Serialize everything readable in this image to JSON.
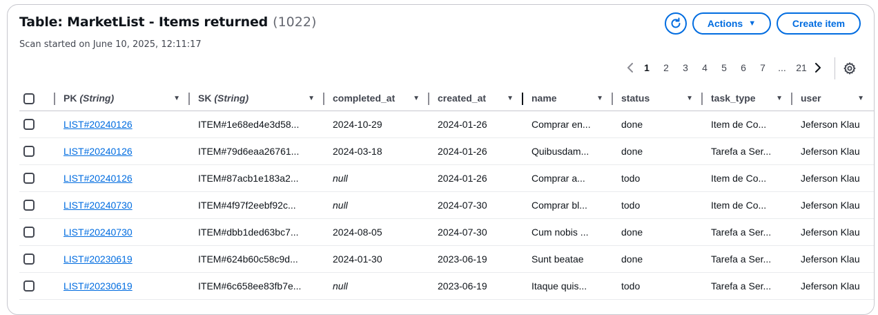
{
  "header": {
    "title": "Table: MarketList - Items returned",
    "count": "(1022)",
    "subtitle": "Scan started on June 10, 2025, 12:11:17",
    "actions_label": "Actions",
    "create_label": "Create item"
  },
  "pagination": {
    "pages": [
      "1",
      "2",
      "3",
      "4",
      "5",
      "6",
      "7"
    ],
    "current": "1",
    "ellipsis": "...",
    "last": "21"
  },
  "columns": [
    {
      "label": "PK",
      "type": "(String)"
    },
    {
      "label": "SK",
      "type": "(String)"
    },
    {
      "label": "completed_at",
      "type": ""
    },
    {
      "label": "created_at",
      "type": ""
    },
    {
      "label": "name",
      "type": ""
    },
    {
      "label": "status",
      "type": ""
    },
    {
      "label": "task_type",
      "type": ""
    },
    {
      "label": "user",
      "type": ""
    }
  ],
  "rows": [
    {
      "pk": "LIST#20240126",
      "sk": "ITEM#1e68ed4e3d58...",
      "completed_at": "2024-10-29",
      "created_at": "2024-01-26",
      "name": "Comprar en...",
      "status": "done",
      "task_type": "Item de Co...",
      "user": "Jeferson Klau"
    },
    {
      "pk": "LIST#20240126",
      "sk": "ITEM#79d6eaa26761...",
      "completed_at": "2024-03-18",
      "created_at": "2024-01-26",
      "name": "Quibusdam...",
      "status": "done",
      "task_type": "Tarefa a Ser...",
      "user": "Jeferson Klau"
    },
    {
      "pk": "LIST#20240126",
      "sk": "ITEM#87acb1e183a2...",
      "completed_at": "null",
      "created_at": "2024-01-26",
      "name": "Comprar a...",
      "status": "todo",
      "task_type": "Item de Co...",
      "user": "Jeferson Klau"
    },
    {
      "pk": "LIST#20240730",
      "sk": "ITEM#4f97f2eebf92c...",
      "completed_at": "null",
      "created_at": "2024-07-30",
      "name": "Comprar bl...",
      "status": "todo",
      "task_type": "Item de Co...",
      "user": "Jeferson Klau"
    },
    {
      "pk": "LIST#20240730",
      "sk": "ITEM#dbb1ded63bc7...",
      "completed_at": "2024-08-05",
      "created_at": "2024-07-30",
      "name": "Cum nobis ...",
      "status": "done",
      "task_type": "Tarefa a Ser...",
      "user": "Jeferson Klau"
    },
    {
      "pk": "LIST#20230619",
      "sk": "ITEM#624b60c58c9d...",
      "completed_at": "2024-01-30",
      "created_at": "2023-06-19",
      "name": "Sunt beatae",
      "status": "done",
      "task_type": "Tarefa a Ser...",
      "user": "Jeferson Klau"
    },
    {
      "pk": "LIST#20230619",
      "sk": "ITEM#6c658ee83fb7e...",
      "completed_at": "null",
      "created_at": "2023-06-19",
      "name": "Itaque quis...",
      "status": "todo",
      "task_type": "Tarefa a Ser...",
      "user": "Jeferson Klau"
    }
  ],
  "icons": {
    "refresh": "refresh-icon",
    "settings": "gear-icon",
    "caret": "caret-down-icon",
    "prev": "chevron-left-icon",
    "next": "chevron-right-icon"
  },
  "colors": {
    "accent": "#006ce0",
    "text": "#0f141a",
    "muted": "#424650",
    "border": "#c6c6cd"
  }
}
